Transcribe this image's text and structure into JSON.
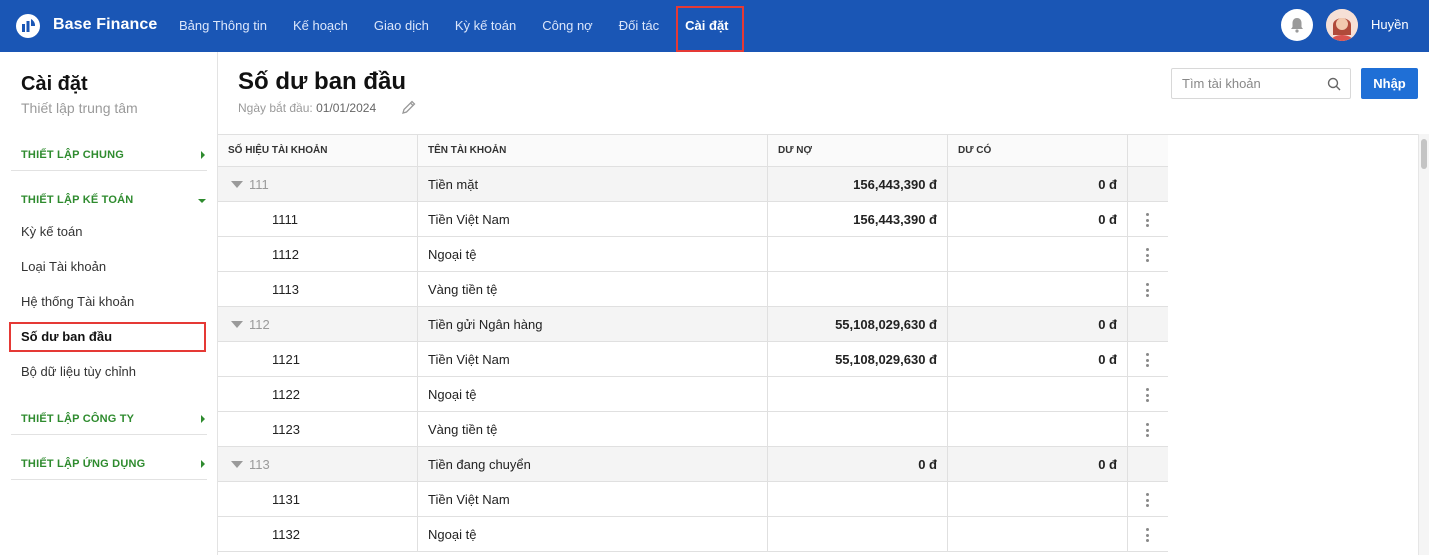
{
  "app": {
    "brand": "Base Finance",
    "user": "Huyền"
  },
  "nav": [
    {
      "label": "Bảng Thông tin"
    },
    {
      "label": "Kế hoạch"
    },
    {
      "label": "Giao dịch"
    },
    {
      "label": "Kỳ kế toán"
    },
    {
      "label": "Công nợ"
    },
    {
      "label": "Đối tác"
    },
    {
      "label": "Cài đặt",
      "active": true
    }
  ],
  "sidebar": {
    "title": "Cài đặt",
    "subtitle": "Thiết lập trung tâm",
    "sections": [
      {
        "label": "THIẾT LẬP CHUNG",
        "expanded": false
      },
      {
        "label": "THIẾT LẬP KẾ TOÁN",
        "expanded": true
      },
      {
        "label": "THIẾT LẬP CÔNG TY",
        "expanded": false
      },
      {
        "label": "THIẾT LẬP ỨNG DỤNG",
        "expanded": false
      }
    ],
    "items": [
      {
        "label": "Kỳ kế toán"
      },
      {
        "label": "Loại Tài khoản"
      },
      {
        "label": "Hệ thống Tài khoản"
      },
      {
        "label": "Số dư ban đầu",
        "active": true
      },
      {
        "label": "Bộ dữ liệu tùy chỉnh"
      }
    ]
  },
  "page": {
    "title": "Số dư ban đầu",
    "start_label": "Ngày bắt đầu:",
    "start_date": "01/01/2024",
    "search_placeholder": "Tìm tài khoản",
    "import_label": "Nhập"
  },
  "table": {
    "columns": [
      "SỐ HIỆU TÀI KHOẢN",
      "TÊN TÀI KHOẢN",
      "DƯ NỢ",
      "DƯ CÓ"
    ],
    "rows": [
      {
        "type": "parent",
        "code": "111",
        "name": "Tiền mặt",
        "debit": "156,443,390 đ",
        "credit": "0 đ"
      },
      {
        "type": "child",
        "code": "1111",
        "name": "Tiền Việt Nam",
        "debit": "156,443,390 đ",
        "credit": "0 đ"
      },
      {
        "type": "child",
        "code": "1112",
        "name": "Ngoại tệ",
        "debit": "",
        "credit": ""
      },
      {
        "type": "child",
        "code": "1113",
        "name": "Vàng tiền tệ",
        "debit": "",
        "credit": ""
      },
      {
        "type": "parent",
        "code": "112",
        "name": "Tiền gửi Ngân hàng",
        "debit": "55,108,029,630 đ",
        "credit": "0 đ"
      },
      {
        "type": "child",
        "code": "1121",
        "name": "Tiền Việt Nam",
        "debit": "55,108,029,630 đ",
        "credit": "0 đ"
      },
      {
        "type": "child",
        "code": "1122",
        "name": "Ngoại tệ",
        "debit": "",
        "credit": ""
      },
      {
        "type": "child",
        "code": "1123",
        "name": "Vàng tiền tệ",
        "debit": "",
        "credit": ""
      },
      {
        "type": "parent",
        "code": "113",
        "name": "Tiền đang chuyển",
        "debit": "0 đ",
        "credit": "0 đ"
      },
      {
        "type": "child",
        "code": "1131",
        "name": "Tiền Việt Nam",
        "debit": "",
        "credit": ""
      },
      {
        "type": "child",
        "code": "1132",
        "name": "Ngoại tệ",
        "debit": "",
        "credit": ""
      }
    ]
  },
  "colors": {
    "topbar": "#1a56b5",
    "accent_green": "#2e8b2e",
    "highlight": "#e53935",
    "primary_button": "#1f6fd6"
  },
  "icons": {
    "logo": "chart-logo-icon",
    "notifications": "bell-icon",
    "search": "search-icon",
    "edit": "pencil-icon",
    "expand": "caret-down-icon",
    "row_menu": "kebab-menu-icon"
  }
}
